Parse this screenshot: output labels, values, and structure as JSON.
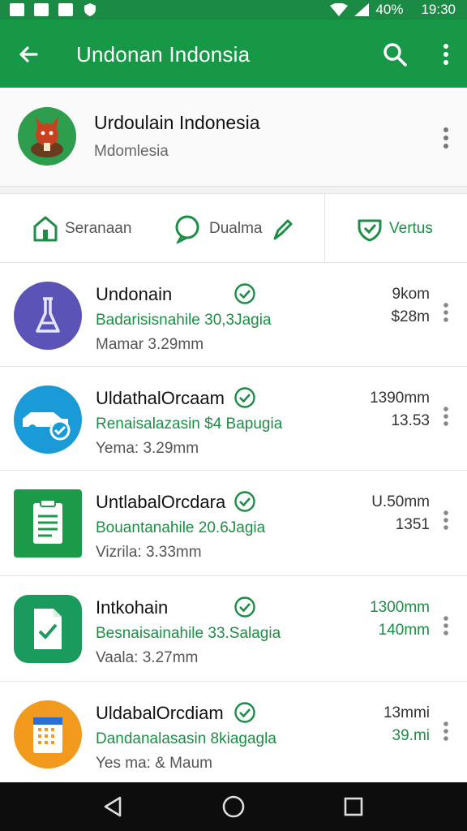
{
  "status": {
    "battery": "40%",
    "time": "19:30"
  },
  "appbar": {
    "title": "Undonan Indonsia"
  },
  "account": {
    "name": "Urdoulain Indonesia",
    "subtitle": "Mdomlesia"
  },
  "tabs": [
    {
      "label": "Seranaan",
      "icon": "home-icon",
      "active": false
    },
    {
      "label": "Dualma",
      "icon": "chat-pen-icon",
      "active": false
    },
    {
      "label": "Vertus",
      "icon": "shield-check-icon",
      "active": true
    }
  ],
  "rows": [
    {
      "title": "Undonain",
      "line2": "Badarisisnahile 30,3Jagia",
      "line3": "Mamar 3.29mm",
      "value1": "9kom",
      "value2": "$28m",
      "icon": "flask-icon",
      "color": "#5b53b5"
    },
    {
      "title": "UldathalOrcaam",
      "line2": "Renaisalazasin $4 Bapugia",
      "line3": "Yema: 3.29mm",
      "value1": "1390mm",
      "value2": "13.53",
      "icon": "car-check-icon",
      "color": "#1a9ad6"
    },
    {
      "title": "UntlabalOrcdara",
      "line2": "Bouantanahile 20.6Jagia",
      "line3": "Vizrila: 3.33mm",
      "value1": "U.50mm",
      "value2": "1351",
      "icon": "clipboard-icon",
      "color": "#1c9a4a"
    },
    {
      "title": "Intkohain",
      "line2": "Besnaisainahile 33.Salagia",
      "line3": "Vaala: 3.27mm",
      "value1": "1300mm",
      "value2": "140mm",
      "icon": "document-check-icon",
      "color": "#1b9a5e",
      "values_green": true
    },
    {
      "title": "UldabalOrcdiam",
      "line2": "Dandanalasasin 8kiagagla",
      "line3": "Yes ma: & Maum",
      "value1": "13mmi",
      "value2": "39.mi",
      "icon": "calendar-icon",
      "color": "#f29a1e",
      "value2_green": true
    }
  ]
}
